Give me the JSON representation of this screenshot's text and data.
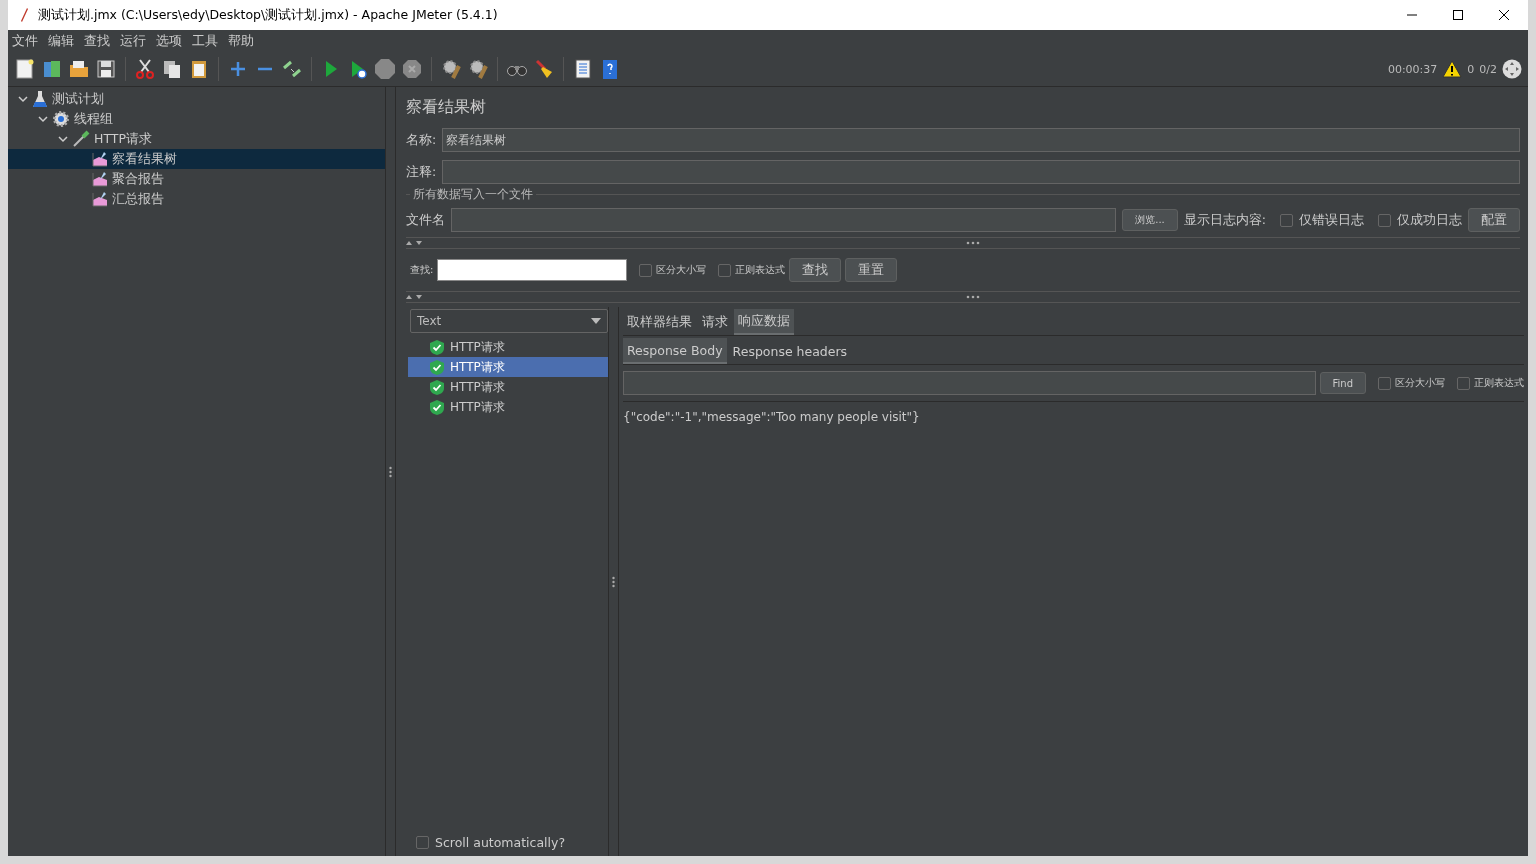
{
  "window": {
    "title": "测试计划.jmx (C:\\Users\\edy\\Desktop\\测试计划.jmx) - Apache JMeter (5.4.1)"
  },
  "menu": [
    "文件",
    "编辑",
    "查找",
    "运行",
    "选项",
    "工具",
    "帮助"
  ],
  "status": {
    "timer": "00:00:37",
    "errors": "0",
    "threads": "0/2"
  },
  "tree": [
    {
      "label": "测试计划",
      "kind": "plan",
      "selected": false,
      "expanded": true,
      "children": [
        {
          "label": "线程组",
          "kind": "threads",
          "selected": false,
          "expanded": true,
          "children": [
            {
              "label": "HTTP请求",
              "kind": "sampler",
              "selected": false,
              "expanded": true,
              "children": [
                {
                  "label": "察看结果树",
                  "kind": "listener",
                  "selected": true
                },
                {
                  "label": "聚合报告",
                  "kind": "listener",
                  "selected": false
                },
                {
                  "label": "汇总报告",
                  "kind": "listener",
                  "selected": false
                }
              ]
            }
          ]
        }
      ]
    }
  ],
  "panel": {
    "title": "察看结果树",
    "name_label": "名称:",
    "name_value": "察看结果树",
    "comment_label": "注释:",
    "file_section": "所有数据写入一个文件",
    "file_label": "文件名",
    "browse": "浏览...",
    "log_label": "显示日志内容:",
    "log_options": [
      {
        "label": "仅错误日志",
        "checked": false
      },
      {
        "label": "仅成功日志",
        "checked": false
      }
    ],
    "configure": "配置"
  },
  "search": {
    "label": "查找:",
    "options": [
      {
        "label": "区分大小写",
        "checked": false
      },
      {
        "label": "正则表达式",
        "checked": false
      }
    ],
    "find": "查找",
    "reset": "重置"
  },
  "results": {
    "renderer": "Text",
    "samples": [
      {
        "label": "HTTP请求",
        "selected": false
      },
      {
        "label": "HTTP请求",
        "selected": true
      },
      {
        "label": "HTTP请求",
        "selected": false
      },
      {
        "label": "HTTP请求",
        "selected": false
      }
    ],
    "scroll": {
      "label": "Scroll automatically?",
      "checked": false
    },
    "tabs": [
      {
        "label": "取样器结果",
        "selected": false
      },
      {
        "label": "请求",
        "selected": false
      },
      {
        "label": "响应数据",
        "selected": true
      }
    ],
    "subtabs": [
      {
        "label": "Response Body",
        "selected": true
      },
      {
        "label": "Response headers",
        "selected": false
      }
    ],
    "find": "Find",
    "find_options": [
      {
        "label": "区分大小写",
        "checked": false
      },
      {
        "label": "正则表达式",
        "checked": false
      }
    ],
    "body": "{\"code\":\"-1\",\"message\":\"Too many people visit\"}"
  }
}
